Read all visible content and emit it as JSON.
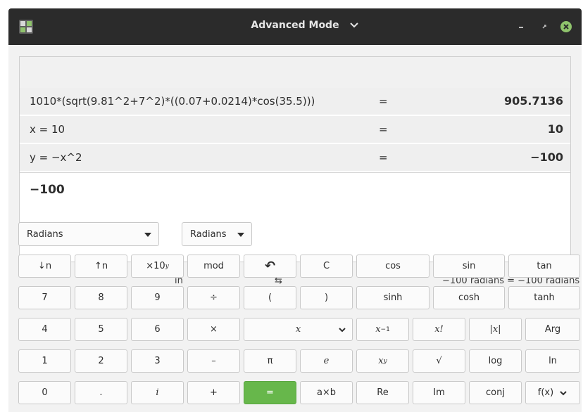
{
  "window": {
    "title": "Advanced Mode"
  },
  "history": [
    {
      "expression": "1010*(sqrt(9.81^2+7^2)*((0.07+0.0214)*cos(35.5)))",
      "equals": "=",
      "result": "905.7136"
    },
    {
      "expression": "x = 10",
      "equals": "=",
      "result": "10"
    },
    {
      "expression": "y = −x^2",
      "equals": "=",
      "result": "−100"
    }
  ],
  "entry": {
    "value": "−100"
  },
  "units": {
    "from_unit": "Radians",
    "in_label": "in",
    "to_unit": "Radians",
    "swap_label": "⇆",
    "conversion": "−100 radians  =  −100 radians"
  },
  "keypad": {
    "row1": {
      "down_n": "↓n",
      "up_n": "↑n",
      "times10": "×10",
      "times10_sup": "y",
      "mod": "mod",
      "undo": "↶",
      "clear": "C",
      "cos": "cos",
      "sin": "sin",
      "tan": "tan"
    },
    "row2": {
      "seven": "7",
      "eight": "8",
      "nine": "9",
      "divide": "÷",
      "lparen": "(",
      "rparen": ")",
      "sinh": "sinh",
      "cosh": "cosh",
      "tanh": "tanh"
    },
    "row3": {
      "four": "4",
      "five": "5",
      "six": "6",
      "multiply": "×",
      "variable": "x",
      "inverse_base": "x",
      "inverse_sup": "−1",
      "factorial": "x!",
      "abs": "|x|",
      "arg": "Arg"
    },
    "row4": {
      "one": "1",
      "two": "2",
      "three": "3",
      "subtract": "–",
      "pi": "π",
      "e": "e",
      "power_base": "x",
      "power_sup": "y",
      "sqrt": "√",
      "log": "log",
      "ln": "ln"
    },
    "row5": {
      "zero": "0",
      "point": ".",
      "imag": "i",
      "add": "+",
      "equals": "=",
      "subscript": "a×b",
      "re": "Re",
      "im": "Im",
      "conj": "conj",
      "fx": "f(x)"
    }
  }
}
